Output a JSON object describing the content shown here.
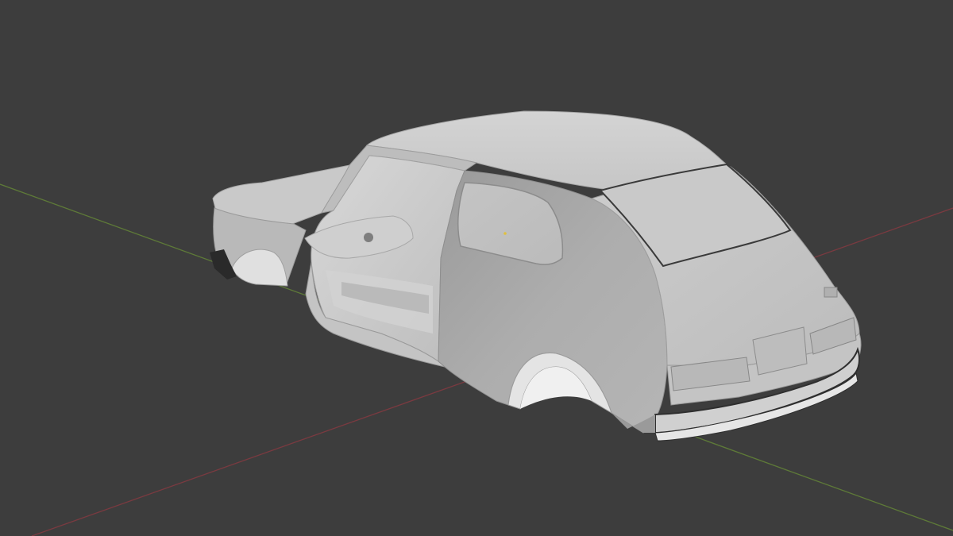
{
  "viewport": {
    "app": "3D viewport",
    "shading_mode": "solid",
    "background_color": "#3d3d3d",
    "x_axis_color": "#8a3a40",
    "y_axis_color": "#6b8a3a",
    "object": {
      "name": "car-body-shell",
      "description_icon": "hatchback-body-mesh",
      "material_color": "#c8c8c8"
    }
  }
}
